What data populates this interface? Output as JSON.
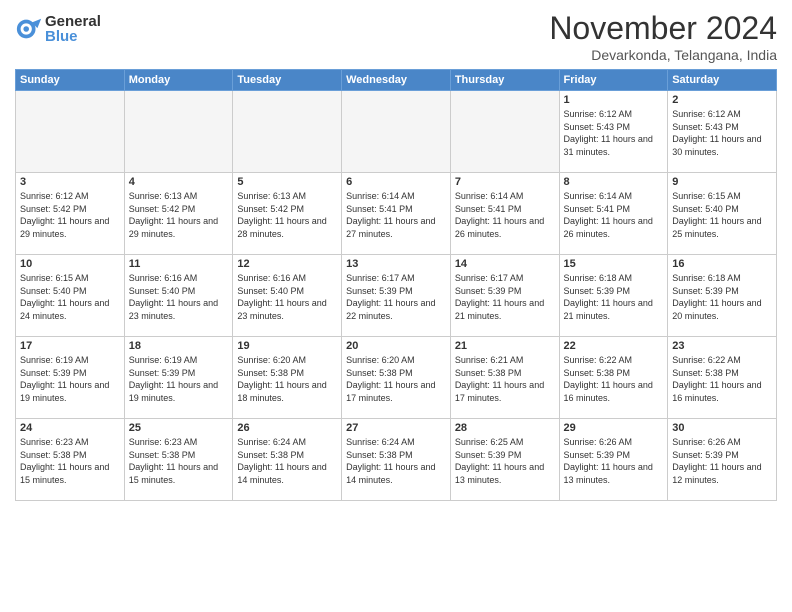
{
  "logo": {
    "general": "General",
    "blue": "Blue"
  },
  "title": "November 2024",
  "location": "Devarkonda, Telangana, India",
  "weekdays": [
    "Sunday",
    "Monday",
    "Tuesday",
    "Wednesday",
    "Thursday",
    "Friday",
    "Saturday"
  ],
  "weeks": [
    [
      {
        "day": "",
        "empty": true
      },
      {
        "day": "",
        "empty": true
      },
      {
        "day": "",
        "empty": true
      },
      {
        "day": "",
        "empty": true
      },
      {
        "day": "",
        "empty": true
      },
      {
        "day": "1",
        "sunrise": "6:12 AM",
        "sunset": "5:43 PM",
        "daylight": "11 hours and 31 minutes."
      },
      {
        "day": "2",
        "sunrise": "6:12 AM",
        "sunset": "5:43 PM",
        "daylight": "11 hours and 30 minutes."
      }
    ],
    [
      {
        "day": "3",
        "sunrise": "6:12 AM",
        "sunset": "5:42 PM",
        "daylight": "11 hours and 29 minutes."
      },
      {
        "day": "4",
        "sunrise": "6:13 AM",
        "sunset": "5:42 PM",
        "daylight": "11 hours and 29 minutes."
      },
      {
        "day": "5",
        "sunrise": "6:13 AM",
        "sunset": "5:42 PM",
        "daylight": "11 hours and 28 minutes."
      },
      {
        "day": "6",
        "sunrise": "6:14 AM",
        "sunset": "5:41 PM",
        "daylight": "11 hours and 27 minutes."
      },
      {
        "day": "7",
        "sunrise": "6:14 AM",
        "sunset": "5:41 PM",
        "daylight": "11 hours and 26 minutes."
      },
      {
        "day": "8",
        "sunrise": "6:14 AM",
        "sunset": "5:41 PM",
        "daylight": "11 hours and 26 minutes."
      },
      {
        "day": "9",
        "sunrise": "6:15 AM",
        "sunset": "5:40 PM",
        "daylight": "11 hours and 25 minutes."
      }
    ],
    [
      {
        "day": "10",
        "sunrise": "6:15 AM",
        "sunset": "5:40 PM",
        "daylight": "11 hours and 24 minutes."
      },
      {
        "day": "11",
        "sunrise": "6:16 AM",
        "sunset": "5:40 PM",
        "daylight": "11 hours and 23 minutes."
      },
      {
        "day": "12",
        "sunrise": "6:16 AM",
        "sunset": "5:40 PM",
        "daylight": "11 hours and 23 minutes."
      },
      {
        "day": "13",
        "sunrise": "6:17 AM",
        "sunset": "5:39 PM",
        "daylight": "11 hours and 22 minutes."
      },
      {
        "day": "14",
        "sunrise": "6:17 AM",
        "sunset": "5:39 PM",
        "daylight": "11 hours and 21 minutes."
      },
      {
        "day": "15",
        "sunrise": "6:18 AM",
        "sunset": "5:39 PM",
        "daylight": "11 hours and 21 minutes."
      },
      {
        "day": "16",
        "sunrise": "6:18 AM",
        "sunset": "5:39 PM",
        "daylight": "11 hours and 20 minutes."
      }
    ],
    [
      {
        "day": "17",
        "sunrise": "6:19 AM",
        "sunset": "5:39 PM",
        "daylight": "11 hours and 19 minutes."
      },
      {
        "day": "18",
        "sunrise": "6:19 AM",
        "sunset": "5:39 PM",
        "daylight": "11 hours and 19 minutes."
      },
      {
        "day": "19",
        "sunrise": "6:20 AM",
        "sunset": "5:38 PM",
        "daylight": "11 hours and 18 minutes."
      },
      {
        "day": "20",
        "sunrise": "6:20 AM",
        "sunset": "5:38 PM",
        "daylight": "11 hours and 17 minutes."
      },
      {
        "day": "21",
        "sunrise": "6:21 AM",
        "sunset": "5:38 PM",
        "daylight": "11 hours and 17 minutes."
      },
      {
        "day": "22",
        "sunrise": "6:22 AM",
        "sunset": "5:38 PM",
        "daylight": "11 hours and 16 minutes."
      },
      {
        "day": "23",
        "sunrise": "6:22 AM",
        "sunset": "5:38 PM",
        "daylight": "11 hours and 16 minutes."
      }
    ],
    [
      {
        "day": "24",
        "sunrise": "6:23 AM",
        "sunset": "5:38 PM",
        "daylight": "11 hours and 15 minutes."
      },
      {
        "day": "25",
        "sunrise": "6:23 AM",
        "sunset": "5:38 PM",
        "daylight": "11 hours and 15 minutes."
      },
      {
        "day": "26",
        "sunrise": "6:24 AM",
        "sunset": "5:38 PM",
        "daylight": "11 hours and 14 minutes."
      },
      {
        "day": "27",
        "sunrise": "6:24 AM",
        "sunset": "5:38 PM",
        "daylight": "11 hours and 14 minutes."
      },
      {
        "day": "28",
        "sunrise": "6:25 AM",
        "sunset": "5:39 PM",
        "daylight": "11 hours and 13 minutes."
      },
      {
        "day": "29",
        "sunrise": "6:26 AM",
        "sunset": "5:39 PM",
        "daylight": "11 hours and 13 minutes."
      },
      {
        "day": "30",
        "sunrise": "6:26 AM",
        "sunset": "5:39 PM",
        "daylight": "11 hours and 12 minutes."
      }
    ]
  ]
}
